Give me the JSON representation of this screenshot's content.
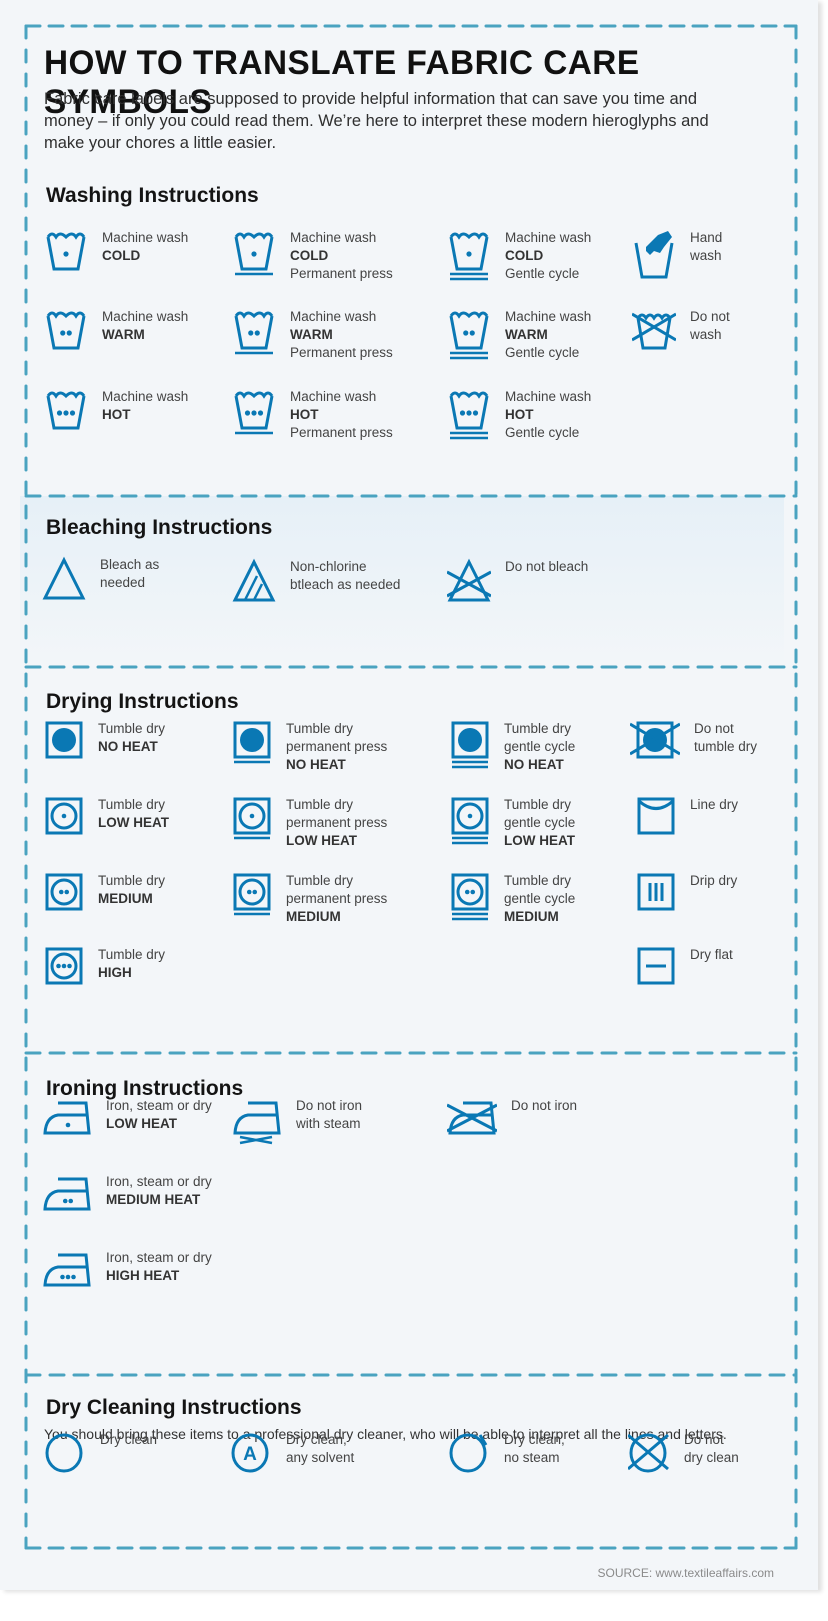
{
  "title": "HOW TO TRANSLATE FABRIC CARE SYMBOLS",
  "intro": "Fabric care labels are supposed to provide helpful information that can save you time and money – if only you could read them. We’re here to interpret these modern hieroglyphs and make your chores a little easier.",
  "colors": {
    "icon": "#0a78b4",
    "border": "#4aa3c0",
    "background": "#f3f6f9"
  },
  "washing": {
    "title": "Washing Instructions",
    "items": [
      {
        "icon": "wash-cold-icon",
        "lines": [
          "Machine wash"
        ],
        "bold": "COLD",
        "extra": ""
      },
      {
        "icon": "wash-cold-permanent-press-icon",
        "lines": [
          "Machine wash"
        ],
        "bold": "COLD",
        "extra": "Permanent press"
      },
      {
        "icon": "wash-cold-gentle-icon",
        "lines": [
          "Machine wash"
        ],
        "bold": "COLD",
        "extra": "Gentle cycle"
      },
      {
        "icon": "hand-wash-icon",
        "lines": [
          "Hand",
          "wash"
        ],
        "bold": "",
        "extra": ""
      },
      {
        "icon": "wash-warm-icon",
        "lines": [
          "Machine wash"
        ],
        "bold": "WARM",
        "extra": ""
      },
      {
        "icon": "wash-warm-permanent-press-icon",
        "lines": [
          "Machine wash"
        ],
        "bold": "WARM",
        "extra": "Permanent press"
      },
      {
        "icon": "wash-warm-gentle-icon",
        "lines": [
          "Machine wash"
        ],
        "bold": "WARM",
        "extra": "Gentle cycle"
      },
      {
        "icon": "do-not-wash-icon",
        "lines": [
          "Do not",
          "wash"
        ],
        "bold": "",
        "extra": ""
      },
      {
        "icon": "wash-hot-icon",
        "lines": [
          "Machine wash"
        ],
        "bold": "HOT",
        "extra": ""
      },
      {
        "icon": "wash-hot-permanent-press-icon",
        "lines": [
          "Machine wash"
        ],
        "bold": "HOT",
        "extra": "Permanent press"
      },
      {
        "icon": "wash-hot-gentle-icon",
        "lines": [
          "Machine wash"
        ],
        "bold": "HOT",
        "extra": "Gentle cycle"
      }
    ]
  },
  "bleaching": {
    "title": "Bleaching Instructions",
    "items": [
      {
        "icon": "bleach-icon",
        "lines": [
          "Bleach as",
          "needed"
        ]
      },
      {
        "icon": "non-chlorine-bleach-icon",
        "lines": [
          "Non-chlorine",
          "btleach as needed"
        ]
      },
      {
        "icon": "do-not-bleach-icon",
        "lines": [
          "Do not bleach"
        ]
      }
    ]
  },
  "drying": {
    "title": "Drying Instructions",
    "items": [
      {
        "icon": "tumble-dry-no-heat-icon",
        "lines": [
          "Tumble dry"
        ],
        "bold": "NO HEAT"
      },
      {
        "icon": "tumble-dry-pp-no-heat-icon",
        "lines": [
          "Tumble dry",
          "permanent press"
        ],
        "bold": "NO HEAT"
      },
      {
        "icon": "tumble-dry-gentle-no-heat-icon",
        "lines": [
          "Tumble dry",
          "gentle cycle"
        ],
        "bold": "NO HEAT"
      },
      {
        "icon": "do-not-tumble-dry-icon",
        "lines": [
          "Do not",
          "tumble dry"
        ],
        "bold": ""
      },
      {
        "icon": "tumble-dry-low-icon",
        "lines": [
          "Tumble dry"
        ],
        "bold": "LOW HEAT"
      },
      {
        "icon": "tumble-dry-pp-low-icon",
        "lines": [
          "Tumble dry",
          "permanent press"
        ],
        "bold": "LOW HEAT"
      },
      {
        "icon": "tumble-dry-gentle-low-icon",
        "lines": [
          "Tumble dry",
          "gentle cycle"
        ],
        "bold": "LOW HEAT"
      },
      {
        "icon": "line-dry-icon",
        "lines": [
          "Line dry"
        ],
        "bold": ""
      },
      {
        "icon": "tumble-dry-medium-icon",
        "lines": [
          "Tumble dry"
        ],
        "bold": "MEDIUM"
      },
      {
        "icon": "tumble-dry-pp-medium-icon",
        "lines": [
          "Tumble dry",
          "permanent press"
        ],
        "bold": "MEDIUM"
      },
      {
        "icon": "tumble-dry-gentle-medium-icon",
        "lines": [
          "Tumble dry",
          "gentle cycle"
        ],
        "bold": "MEDIUM"
      },
      {
        "icon": "drip-dry-icon",
        "lines": [
          "Drip dry"
        ],
        "bold": ""
      },
      {
        "icon": "tumble-dry-high-icon",
        "lines": [
          "Tumble dry"
        ],
        "bold": "HIGH"
      },
      {
        "icon": "dry-flat-icon",
        "lines": [
          "Dry flat"
        ],
        "bold": ""
      }
    ]
  },
  "ironing": {
    "title": "Ironing Instructions",
    "items": [
      {
        "icon": "iron-low-heat-icon",
        "lines": [
          "Iron, steam or dry"
        ],
        "bold": "LOW HEAT"
      },
      {
        "icon": "do-not-steam-icon",
        "lines": [
          "Do not iron",
          "with steam"
        ],
        "bold": ""
      },
      {
        "icon": "do-not-iron-icon",
        "lines": [
          "Do not iron"
        ],
        "bold": ""
      },
      {
        "icon": "iron-medium-heat-icon",
        "lines": [
          "Iron, steam or dry"
        ],
        "bold": "MEDIUM HEAT"
      },
      {
        "icon": "iron-high-heat-icon",
        "lines": [
          "Iron, steam or dry"
        ],
        "bold": "HIGH HEAT"
      }
    ]
  },
  "dry_cleaning": {
    "title": "Dry Cleaning Instructions",
    "subtitle": "You should bring these items to a professional dry cleaner, who will be able to interpret all the lines and letters.",
    "items": [
      {
        "icon": "dry-clean-icon",
        "lines": [
          "Dry clean"
        ]
      },
      {
        "icon": "dry-clean-any-solvent-icon",
        "lines": [
          "Dry clean,",
          "any solvent"
        ],
        "letter": "A"
      },
      {
        "icon": "dry-clean-no-steam-icon",
        "lines": [
          "Dry clean,",
          "no steam"
        ]
      },
      {
        "icon": "do-not-dry-clean-icon",
        "lines": [
          "Do not",
          "dry clean"
        ]
      }
    ]
  },
  "source": "SOURCE: www.textileaffairs.com"
}
